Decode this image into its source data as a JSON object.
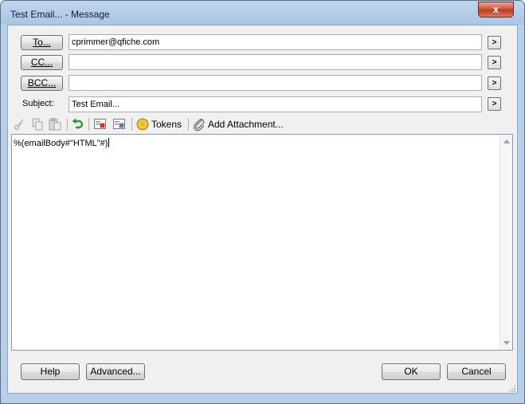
{
  "window": {
    "title": "Test Email... - Message",
    "close_label": "x"
  },
  "recipients": {
    "to_label": "To...",
    "to_value": "cprimmer@qfiche.com",
    "cc_label": "CC...",
    "cc_value": "",
    "bcc_label": "BCC...",
    "bcc_value": "",
    "subject_label": "Subject:",
    "subject_value": "Test Email...",
    "expand_label": ">"
  },
  "toolbar": {
    "cut_icon": "scissors-icon",
    "copy_icon": "copy-icon",
    "paste_icon": "paste-icon",
    "undo_icon": "undo-arrow-icon",
    "tokens_label": "Tokens",
    "attachment_label": "Add Attachment..."
  },
  "editor": {
    "body_text": "%(emailBody#\"HTML\"#)"
  },
  "footer": {
    "help_label": "Help",
    "advanced_label": "Advanced...",
    "ok_label": "OK",
    "cancel_label": "Cancel"
  },
  "colors": {
    "titlebar": "#a9c6e6",
    "close_red": "#c03a22",
    "dialog_bg": "#f0f0f0",
    "tokens_gold": "#e8b920",
    "undo_green": "#2a9a2a"
  }
}
